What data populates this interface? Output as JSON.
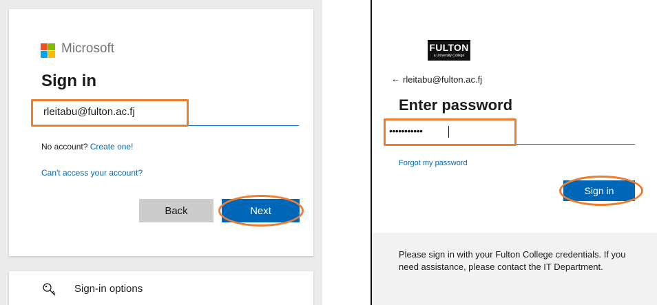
{
  "left_panel": {
    "brand": "Microsoft",
    "title": "Sign in",
    "email_value": "rleitabu@fulton.ac.fj",
    "no_account_text": "No account?",
    "create_link": "Create one!",
    "cant_access_link": "Can't access your account?",
    "back_label": "Back",
    "next_label": "Next",
    "signin_options_label": "Sign-in options"
  },
  "right_panel": {
    "logo_name": "FULTON",
    "logo_sub": "a University College",
    "back_arrow": "←",
    "user_email": "rleitabu@fulton.ac.fj",
    "title": "Enter password",
    "password_masked": "•••••••••••",
    "forgot_link": "Forgot my password",
    "signin_label": "Sign in",
    "footer_text": "Please sign in with your Fulton College credentials. If you need assistance, please contact the IT Department."
  },
  "colors": {
    "accent": "#0067b8",
    "highlight": "#ee7d31",
    "ms_red": "#f25022",
    "ms_green": "#7fba00",
    "ms_blue": "#00a4ef",
    "ms_yellow": "#ffb900"
  },
  "icons": {
    "key": "key-icon",
    "ms_logo": "microsoft-logo-icon"
  }
}
